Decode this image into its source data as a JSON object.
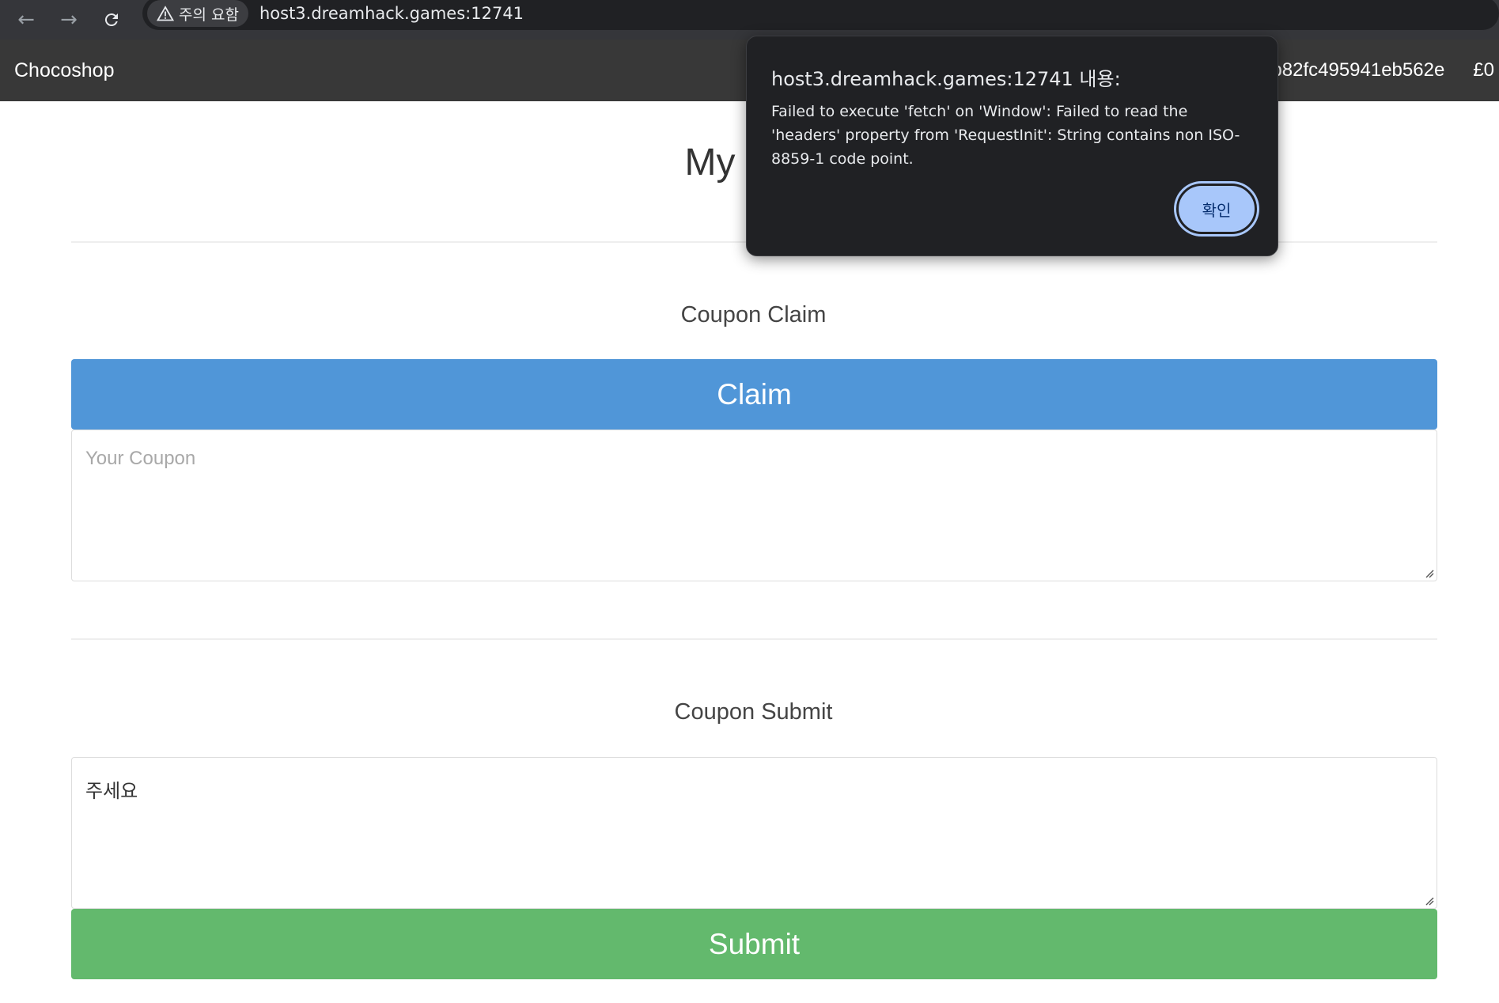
{
  "browser": {
    "security_label": "주의 요함",
    "url": "host3.dreamhack.games:12741"
  },
  "navbar": {
    "brand": "Chocoshop",
    "session_id": "b82fc495941eb562e",
    "balance": "£0"
  },
  "page": {
    "title": "My"
  },
  "claim_section": {
    "heading": "Coupon Claim",
    "button_label": "Claim",
    "coupon_placeholder": "Your Coupon"
  },
  "submit_section": {
    "heading": "Coupon Submit",
    "coupon_value": "주세요",
    "button_label": "Submit"
  },
  "dialog": {
    "title": "host3.dreamhack.games:12741 내용:",
    "message": "Failed to execute 'fetch' on 'Window': Failed to read the 'headers' property from 'RequestInit': String contains non ISO-8859-1 code point.",
    "ok_label": "확인"
  },
  "icons": {
    "back": "arrow-left-icon",
    "forward": "arrow-right-icon",
    "reload": "reload-icon",
    "warning": "warning-triangle-icon"
  },
  "colors": {
    "claim_button": "#5096d8",
    "submit_button": "#63b96d",
    "navbar": "#383838",
    "dialog_button": "#a8c7fa"
  }
}
